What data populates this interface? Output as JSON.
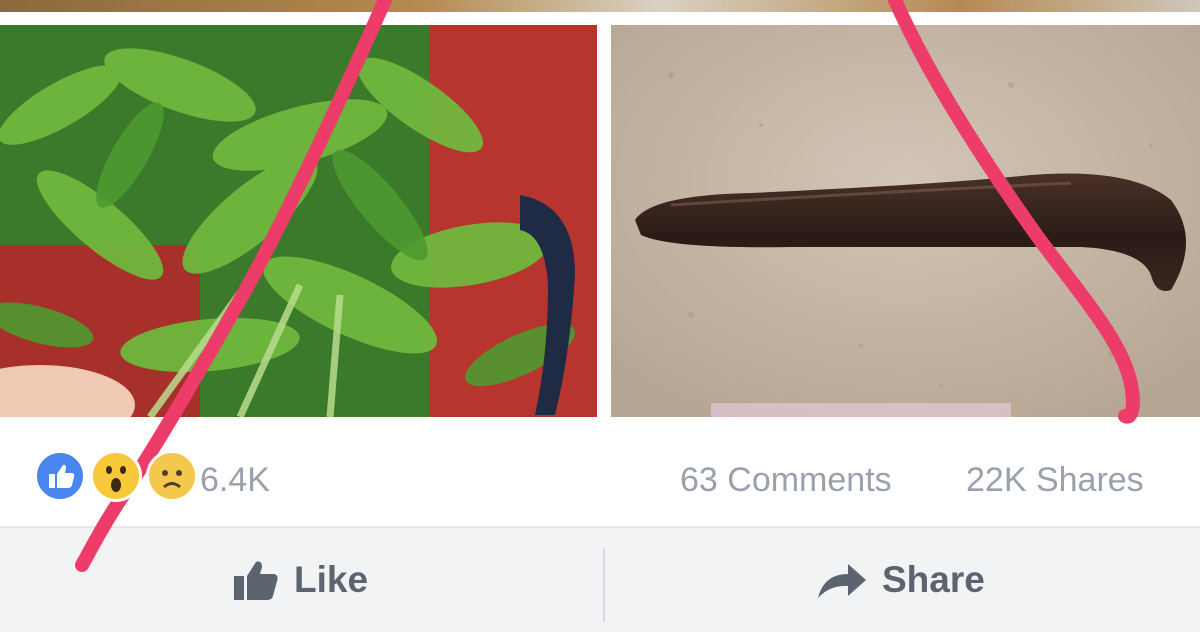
{
  "post": {
    "photos": [
      {
        "subject": "leafy green vegetables"
      },
      {
        "subject": "leech on concrete"
      }
    ],
    "stats": {
      "reaction_count": "6.4K",
      "comments": "63 Comments",
      "shares": "22K Shares",
      "reactions": [
        "like-icon",
        "wow-icon",
        "sad-icon"
      ]
    },
    "actions": {
      "like_label": "Like",
      "share_label": "Share"
    }
  },
  "colors": {
    "facebook_blue": "#4a86f0",
    "muted_text": "#9aa1ad",
    "action_text": "#5c6470",
    "annotation_red": "#ee3c6a"
  }
}
